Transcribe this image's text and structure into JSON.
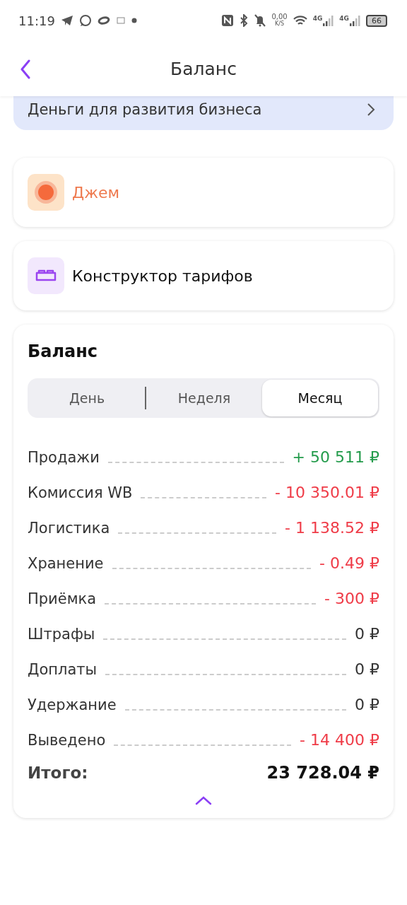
{
  "status_bar": {
    "time": "11:19",
    "speed_value": "0,00",
    "speed_unit": "K/S",
    "network_1": "4G",
    "network_2": "4G",
    "battery": "66"
  },
  "header": {
    "title": "Баланс"
  },
  "banner": {
    "text": "Деньги для развития бизнеса"
  },
  "cards": [
    {
      "kind": "jam",
      "label": "Джем"
    },
    {
      "kind": "tariff",
      "label": "Конструктор тарифов"
    }
  ],
  "balance": {
    "title": "Баланс",
    "periods": [
      {
        "label": "День",
        "selected": false
      },
      {
        "label": "Неделя",
        "selected": false
      },
      {
        "label": "Месяц",
        "selected": true
      }
    ],
    "rows": [
      {
        "label": "Продажи",
        "value": "+ 50 511 ₽",
        "kind": "positive"
      },
      {
        "label": "Комиссия WB",
        "value": "- 10 350.01 ₽",
        "kind": "negative"
      },
      {
        "label": "Логистика",
        "value": "- 1 138.52 ₽",
        "kind": "negative"
      },
      {
        "label": "Хранение",
        "value": "- 0.49 ₽",
        "kind": "negative"
      },
      {
        "label": "Приёмка",
        "value": "- 300 ₽",
        "kind": "negative"
      },
      {
        "label": "Штрафы",
        "value": "0 ₽",
        "kind": "zero"
      },
      {
        "label": "Доплаты",
        "value": "0 ₽",
        "kind": "zero"
      },
      {
        "label": "Удержание",
        "value": "0 ₽",
        "kind": "zero"
      },
      {
        "label": "Выведено",
        "value": "- 14 400 ₽",
        "kind": "negative"
      }
    ],
    "total_label": "Итого:",
    "total_value": "23 728.04 ₽",
    "expanded": true
  }
}
